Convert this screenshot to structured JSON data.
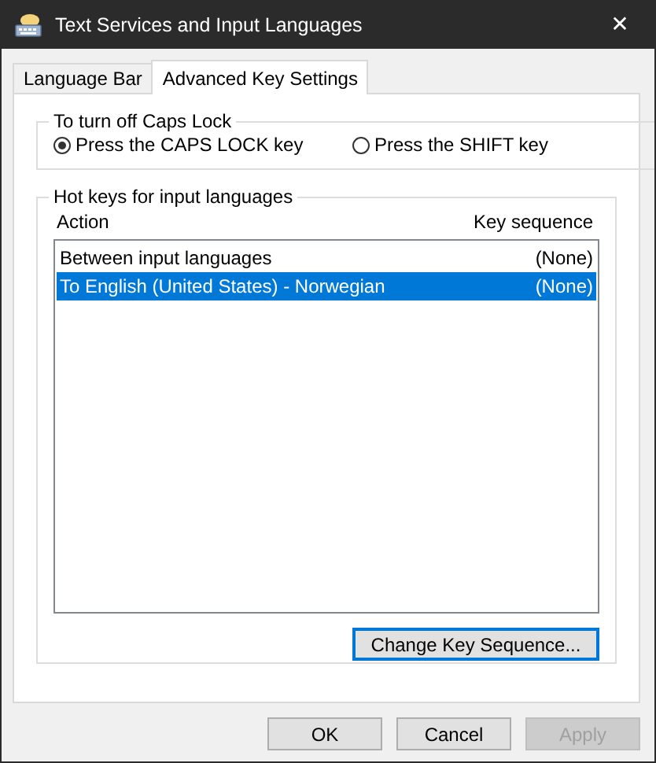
{
  "window": {
    "title": "Text Services and Input Languages",
    "close": "✕"
  },
  "tabs": [
    {
      "label": "Language Bar",
      "selected": false
    },
    {
      "label": "Advanced Key Settings",
      "selected": true
    }
  ],
  "caps_lock": {
    "title": "To turn off Caps Lock",
    "options": [
      {
        "label": "Press the CAPS LOCK key",
        "selected": true
      },
      {
        "label": "Press the SHIFT key",
        "selected": false
      }
    ]
  },
  "hot_keys": {
    "title": "Hot keys for input languages",
    "columns": [
      "Action",
      "Key sequence"
    ],
    "rows": [
      {
        "action": "Between input languages",
        "key_sequence": "(None)",
        "selected": false
      },
      {
        "action": "To English (United States) - Norwegian",
        "key_sequence": "(None)",
        "selected": true
      }
    ],
    "button": "Change Key Sequence..."
  },
  "buttons": [
    {
      "label": "OK",
      "disabled": false
    },
    {
      "label": "Cancel",
      "disabled": false
    },
    {
      "label": "Apply",
      "disabled": true
    }
  ]
}
